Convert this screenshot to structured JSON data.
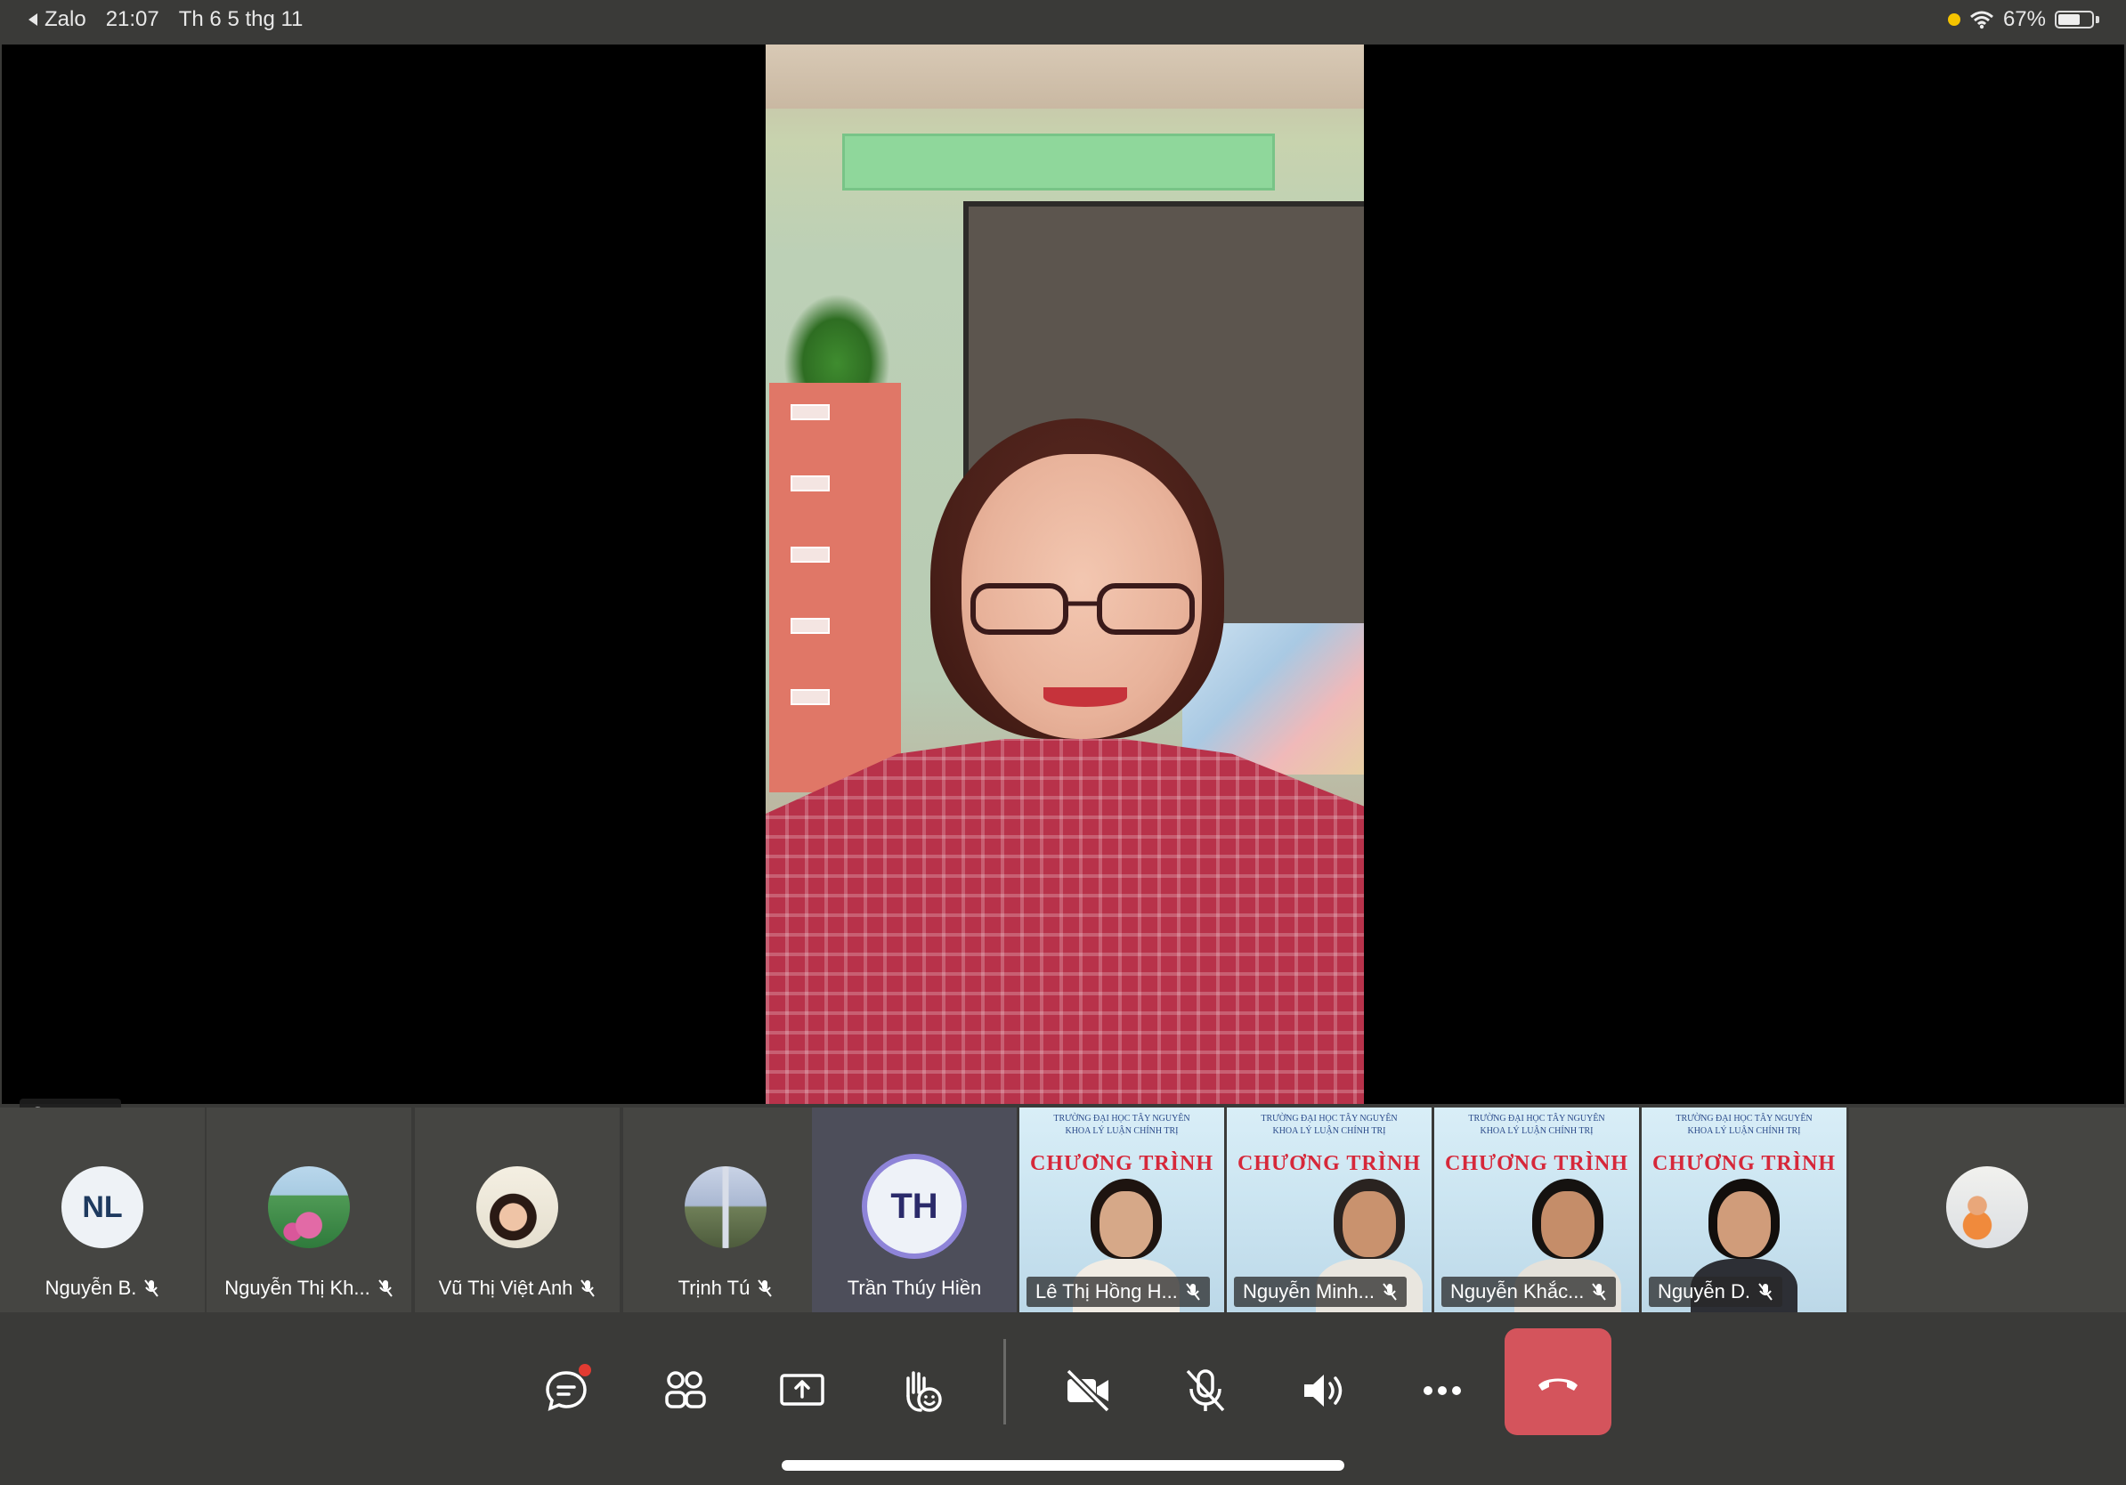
{
  "status_bar": {
    "back_app": "Zalo",
    "time": "21:07",
    "date": "Th 6 5 thg 11",
    "battery_percent": "67%",
    "battery_level": 0.67
  },
  "main_video": {
    "pinned_label": "Cựu v."
  },
  "participants": [
    {
      "name": "Nguyễn B.",
      "avatar_type": "initials",
      "initials": "NL",
      "mic": "muted"
    },
    {
      "name": "Nguyễn Thị Kh...",
      "avatar_type": "photo",
      "avatar_icon": "lotus-photo",
      "mic": "muted"
    },
    {
      "name": "Vũ Thị Việt Anh",
      "avatar_type": "photo",
      "avatar_icon": "portrait-photo",
      "mic": "muted"
    },
    {
      "name": "Trịnh Tú",
      "avatar_type": "photo",
      "avatar_icon": "field-photo",
      "mic": "muted"
    },
    {
      "name": "Trần Thúy Hiền",
      "avatar_type": "initials",
      "initials": "TH",
      "speaking": true
    },
    {
      "name": "Lê Thị Hồng H...",
      "avatar_type": "video",
      "mic": "muted"
    },
    {
      "name": "Nguyễn Minh...",
      "avatar_type": "video",
      "mic": "muted"
    },
    {
      "name": "Nguyễn Khắc...",
      "avatar_type": "video",
      "mic": "muted"
    },
    {
      "name": "Nguyễn D.",
      "avatar_type": "video",
      "mic": "muted"
    },
    {
      "name": "",
      "avatar_type": "photo",
      "avatar_icon": "office-photo"
    }
  ],
  "controls": {
    "chat_icon": "chat-icon",
    "participants_icon": "participants-icon",
    "share_icon": "share-screen-icon",
    "reaction_icon": "raise-hand-icon",
    "camera_icon": "camera-off-icon",
    "mic_icon": "mic-off-icon",
    "speaker_icon": "speaker-icon",
    "more_icon": "more-icon",
    "end_call_icon": "end-call-icon",
    "end_call_color": "#d4545c"
  }
}
